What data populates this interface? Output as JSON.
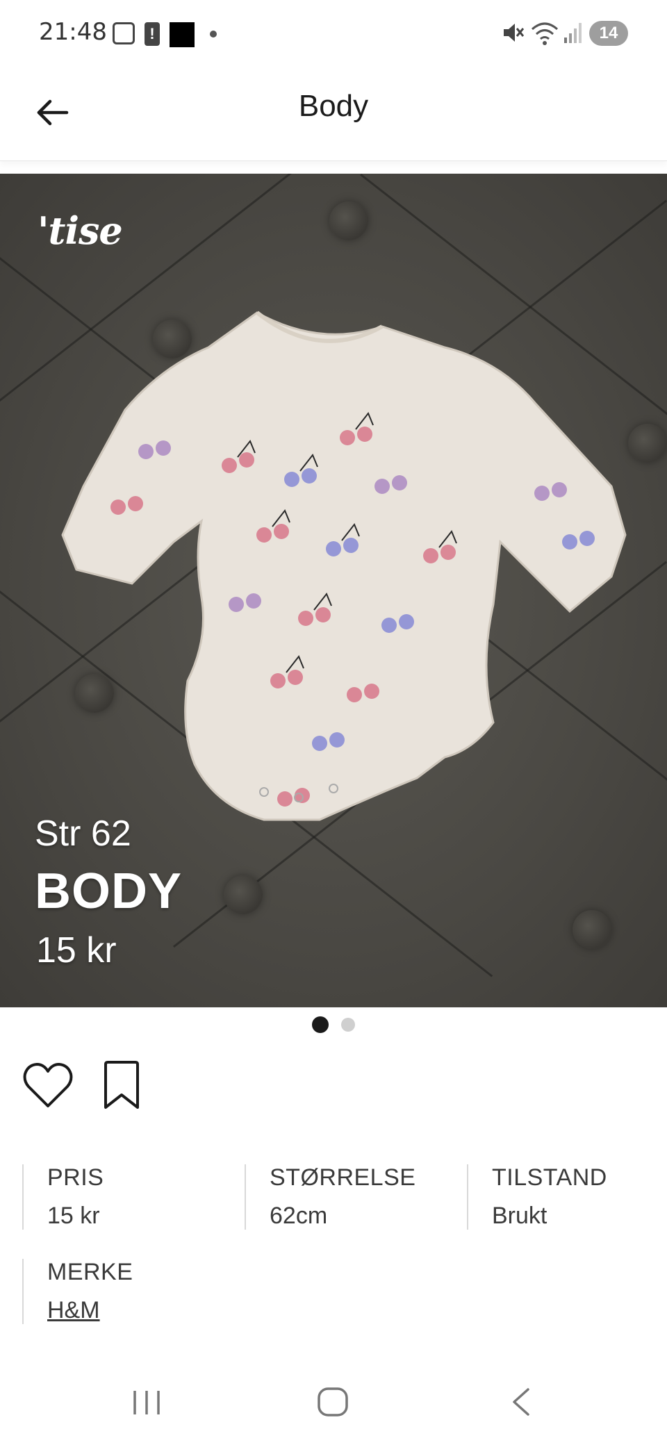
{
  "status_bar": {
    "time": "21:48",
    "notification_count": "14",
    "icons": [
      "screenshot-icon",
      "alert-icon",
      "app-notification-icon",
      "mute-icon",
      "wifi-icon",
      "signal-icon"
    ]
  },
  "app_bar": {
    "title": "Body",
    "back_icon": "arrow-left-icon"
  },
  "listing_image": {
    "brand": "'tise",
    "overlay_size": "Str 62",
    "overlay_title": "BODY",
    "overlay_price": "15 kr",
    "page_count": 2,
    "current_page": 1
  },
  "actions": {
    "like_icon": "heart-icon",
    "save_icon": "bookmark-icon"
  },
  "details": [
    {
      "label": "PRIS",
      "value": "15 kr"
    },
    {
      "label": "STØRRELSE",
      "value": "62cm"
    },
    {
      "label": "TILSTAND",
      "value": "Brukt"
    },
    {
      "label": "MERKE",
      "value": "H&M"
    }
  ],
  "nav_bar": {
    "icons": [
      "recent-apps-icon",
      "home-icon",
      "back-icon"
    ]
  },
  "colors": {
    "text": "#1a1a1a",
    "divider": "#d8d8d8",
    "background": "#ffffff",
    "photo_background": "#4a4843"
  }
}
